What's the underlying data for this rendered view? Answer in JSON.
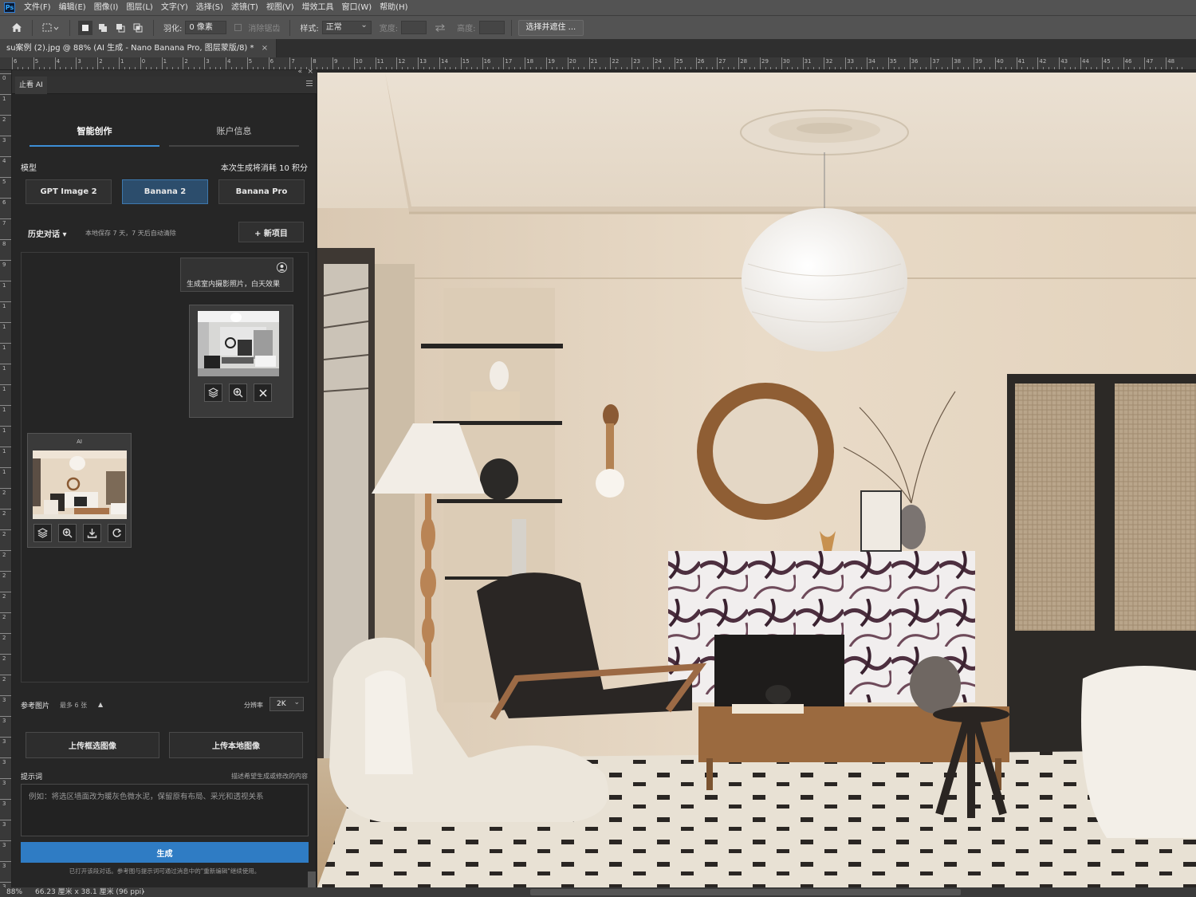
{
  "menubar": {
    "app_icon": "Ps",
    "items": [
      "文件(F)",
      "编辑(E)",
      "图像(I)",
      "图层(L)",
      "文字(Y)",
      "选择(S)",
      "滤镜(T)",
      "视图(V)",
      "增效工具",
      "窗口(W)",
      "帮助(H)"
    ]
  },
  "options": {
    "feather_label": "羽化:",
    "feather_value": "0 像素",
    "antialias_label": "消除锯齿",
    "style_label": "样式:",
    "style_value": "正常",
    "width_label": "宽度:",
    "height_label": "高度:",
    "select_mask_button": "选择并遮住 ..."
  },
  "document_tab": {
    "title": "su案例 (2).jpg @ 88% (AI 生成 - Nano Banana Pro, 图层蒙版/8) *",
    "close": "×"
  },
  "ruler": {
    "h_labels": [
      "6",
      "5",
      "4",
      "3",
      "2",
      "1",
      "0",
      "1",
      "2",
      "3",
      "4",
      "5",
      "6",
      "7",
      "8",
      "9",
      "10",
      "11",
      "12",
      "13",
      "14",
      "15",
      "16",
      "17",
      "18",
      "19",
      "20",
      "21",
      "22",
      "23",
      "24",
      "25",
      "26",
      "27",
      "28",
      "29",
      "30",
      "31",
      "32",
      "33",
      "34",
      "35",
      "36",
      "37",
      "38",
      "39",
      "40",
      "41",
      "42",
      "43",
      "44",
      "45",
      "46",
      "47",
      "48"
    ],
    "v_labels": [
      "0",
      "1",
      "2",
      "3",
      "4",
      "5",
      "6",
      "7",
      "8",
      "9",
      "1",
      "1",
      "1",
      "1",
      "1",
      "1",
      "1",
      "1",
      "1",
      "1",
      "2",
      "2",
      "2",
      "2",
      "2",
      "2",
      "2",
      "2",
      "2",
      "2",
      "3",
      "3",
      "3",
      "3",
      "3",
      "3",
      "3",
      "3",
      "3",
      "3"
    ]
  },
  "panel": {
    "collapse": "«",
    "close": "×",
    "title": "止看 AI",
    "tabs": [
      {
        "label": "智能创作",
        "active": true
      },
      {
        "label": "账户信息",
        "active": false
      }
    ],
    "model_label": "模型",
    "cost_text": "本次生成将消耗 10 积分",
    "models": [
      {
        "label": "GPT Image 2",
        "active": false
      },
      {
        "label": "Banana 2",
        "active": true
      },
      {
        "label": "Banana Pro",
        "active": false
      }
    ],
    "history_label": "历史对话 ▾",
    "history_note": "本地保存 7 天，7 天后自动清除",
    "new_project": "+ 新项目",
    "user_message": "生成室内摄影照片，白天效果",
    "ai_label": "AI",
    "reference_label": "参考图片",
    "reference_limit": "最多 6 张",
    "reference_toggle": "▲",
    "resolution_label": "分辨率",
    "resolution_value": "2K",
    "upload_selection": "上传框选图像",
    "upload_local": "上传本地图像",
    "prompt_label": "提示词",
    "prompt_hint": "描述希望生成或修改的内容",
    "prompt_placeholder": "例如：将选区墙面改为暖灰色微水泥，保留原有布局、采光和透视关系",
    "generate_button": "生成",
    "footer_note": "已打开该段对话。参考图与提示词可通过消息中的\"重新编辑\"继续使用。"
  },
  "status": {
    "zoom": "88%",
    "doc_size": "66.23 厘米 x 38.1 厘米 (96 ppi)",
    "arrow": "›"
  },
  "colors": {
    "accent": "#2f7cc4",
    "active_model": "#2c4d6c"
  }
}
